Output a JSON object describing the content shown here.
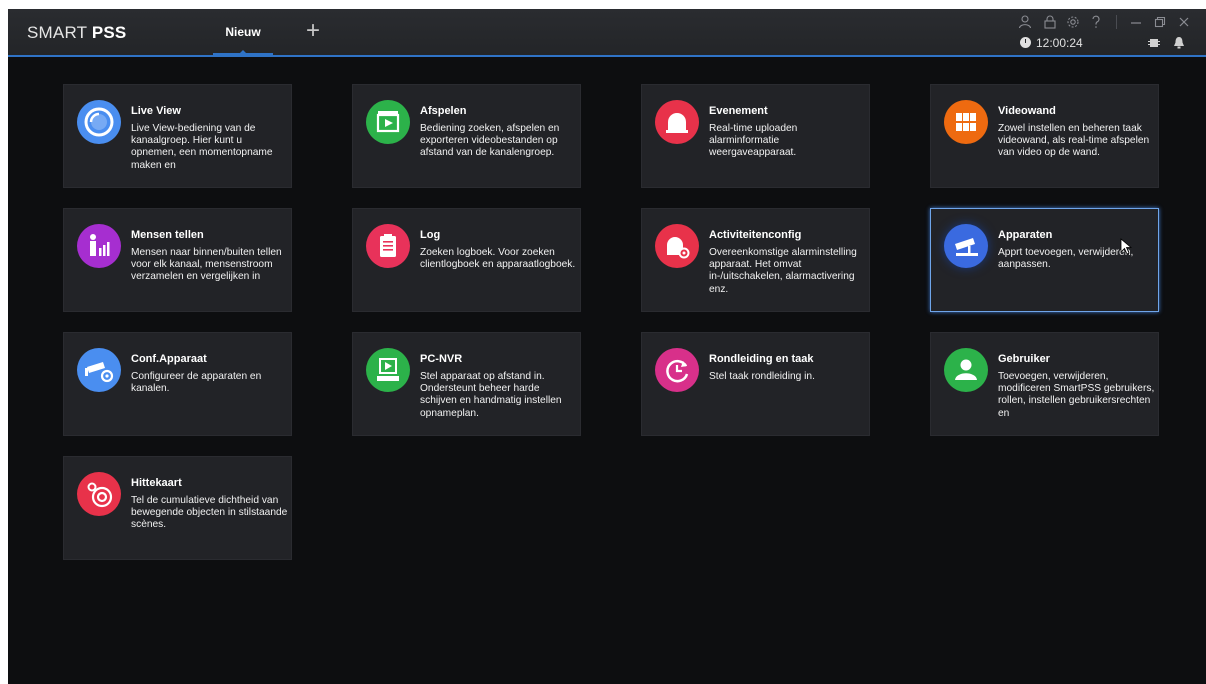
{
  "app": {
    "brand_light": "SMART ",
    "brand_bold": "PSS",
    "tab_label": "Nieuw",
    "add_tab_glyph": "+",
    "clock_time": "12:00:24",
    "accent_color": "#2f73c6"
  },
  "tiles": [
    {
      "title": "Live View",
      "desc": "Live View-bediening van de kanaalgroep. Hier kunt u opnemen, een momentopname maken en",
      "icon": "live-view-icon",
      "color": "#4a8ef0"
    },
    {
      "title": "Afspelen",
      "desc": "Bediening zoeken, afspelen en exporteren videobestanden op afstand van de kanalengroep.",
      "icon": "playback-icon",
      "color": "#2cb24a"
    },
    {
      "title": "Evenement",
      "desc": "Real-time uploaden alarminformatie weergaveapparaat.",
      "icon": "alarm-icon",
      "color": "#e8324a"
    },
    {
      "title": "Videowand",
      "desc": "Zowel instellen en beheren taak videowand, als real-time afspelen van video op de wand.",
      "icon": "video-wall-icon",
      "color": "#ee6a10"
    },
    {
      "title": "Mensen tellen",
      "desc": "Mensen naar binnen/buiten tellen voor elk kanaal, mensenstroom verzamelen en vergelijken in",
      "icon": "people-count-icon",
      "color": "#a62ed0"
    },
    {
      "title": "Log",
      "desc": "Zoeken logboek. Voor zoeken clientlogboek en apparaatlogboek.",
      "icon": "log-icon",
      "color": "#e8325a"
    },
    {
      "title": "Activiteitenconfig",
      "desc": "Overeenkomstige alarminstelling apparaat. Het omvat in-/uitschakelen, alarmactivering enz.",
      "icon": "alarm-config-icon",
      "color": "#e8324a"
    },
    {
      "title": "Apparaten",
      "desc": "Apprt toevoegen, verwijderen, aanpassen.",
      "icon": "devices-icon",
      "color": "#3a6ae0"
    },
    {
      "title": "Conf.Apparaat",
      "desc": "Configureer de apparaten en kanalen.",
      "icon": "device-config-icon",
      "color": "#4a8ef0"
    },
    {
      "title": "PC-NVR",
      "desc": "Stel apparaat op afstand in. Ondersteunt beheer harde schijven en handmatig instellen opnameplan.",
      "icon": "pc-nvr-icon",
      "color": "#2cb24a"
    },
    {
      "title": "Rondleiding en taak",
      "desc": "Stel taak rondleiding in.",
      "icon": "tour-icon",
      "color": "#d8308a"
    },
    {
      "title": "Gebruiker",
      "desc": "Toevoegen, verwijderen, modificeren SmartPSS gebruikers, rollen, instellen gebruikersrechten en",
      "icon": "user-icon",
      "color": "#2cb24a"
    },
    {
      "title": "Hittekaart",
      "desc": "Tel de cumulatieve dichtheid van bewegende objecten in stilstaande scènes.",
      "icon": "heatmap-icon",
      "color": "#e8324a"
    }
  ]
}
